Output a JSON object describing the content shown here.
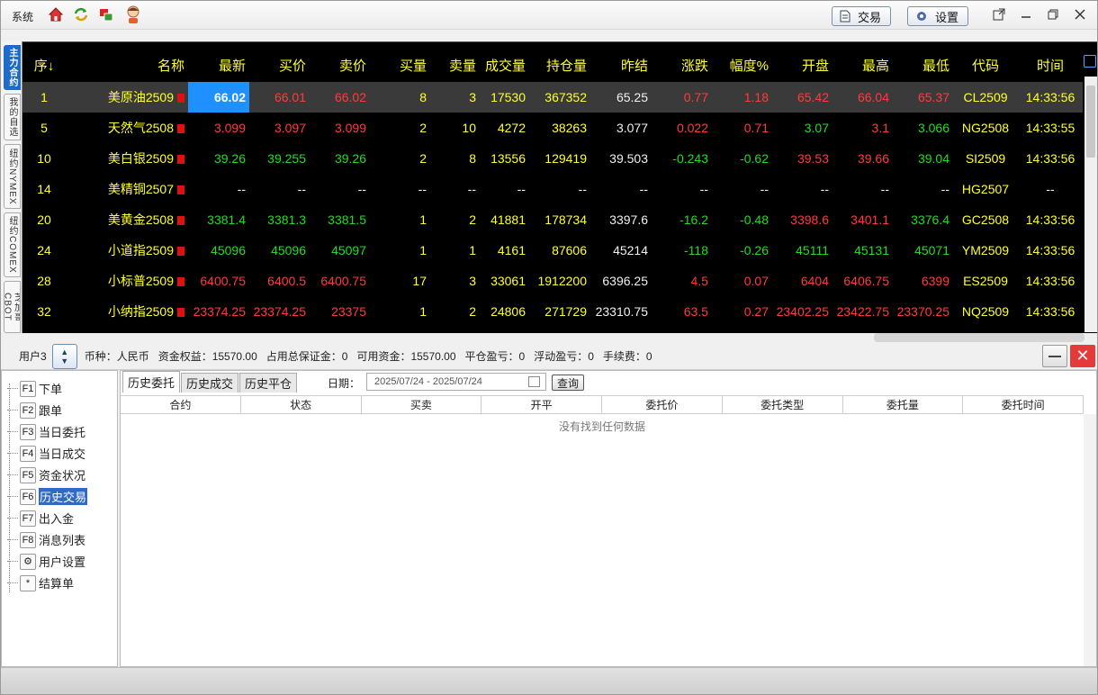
{
  "titlebar": {
    "menu_system": "系统",
    "btn_trade": "交易",
    "btn_settings": "设置"
  },
  "side_tabs": [
    "主力合约",
    "我的自选",
    "纽约NYMEX",
    "纽约COMEX",
    "芝加哥CBOT"
  ],
  "quote": {
    "columns": [
      "序↓",
      "名称",
      "最新",
      "买价",
      "卖价",
      "买量",
      "卖量",
      "成交量",
      "持仓量",
      "昨结",
      "涨跌",
      "幅度%",
      "开盘",
      "最高",
      "最低",
      "代码",
      "时间"
    ],
    "rows": [
      {
        "seq": "1",
        "name": "美原油2509",
        "last": "66.02",
        "bid": "66.01",
        "ask": "66.02",
        "bidv": "8",
        "askv": "3",
        "vol": "17530",
        "oi": "367352",
        "prev": "65.25",
        "chg": "0.77",
        "pct": "1.18",
        "open": "65.42",
        "high": "66.04",
        "low": "65.37",
        "code": "CL2509",
        "time": "14:33:56"
      },
      {
        "seq": "5",
        "name": "天然气2508",
        "last": "3.099",
        "bid": "3.097",
        "ask": "3.099",
        "bidv": "2",
        "askv": "10",
        "vol": "4272",
        "oi": "38263",
        "prev": "3.077",
        "chg": "0.022",
        "pct": "0.71",
        "open": "3.07",
        "high": "3.1",
        "low": "3.066",
        "code": "NG2508",
        "time": "14:33:55"
      },
      {
        "seq": "10",
        "name": "美白银2509",
        "last": "39.26",
        "bid": "39.255",
        "ask": "39.26",
        "bidv": "2",
        "askv": "8",
        "vol": "13556",
        "oi": "129419",
        "prev": "39.503",
        "chg": "-0.243",
        "pct": "-0.62",
        "open": "39.53",
        "high": "39.66",
        "low": "39.04",
        "code": "SI2509",
        "time": "14:33:56"
      },
      {
        "seq": "14",
        "name": "美精铜2507",
        "last": "--",
        "bid": "--",
        "ask": "--",
        "bidv": "--",
        "askv": "--",
        "vol": "--",
        "oi": "--",
        "prev": "--",
        "chg": "--",
        "pct": "--",
        "open": "--",
        "high": "--",
        "low": "--",
        "code": "HG2507",
        "time": "--"
      },
      {
        "seq": "20",
        "name": "美黄金2508",
        "last": "3381.4",
        "bid": "3381.3",
        "ask": "3381.5",
        "bidv": "1",
        "askv": "2",
        "vol": "41881",
        "oi": "178734",
        "prev": "3397.6",
        "chg": "-16.2",
        "pct": "-0.48",
        "open": "3398.6",
        "high": "3401.1",
        "low": "3376.4",
        "code": "GC2508",
        "time": "14:33:56"
      },
      {
        "seq": "24",
        "name": "小道指2509",
        "last": "45096",
        "bid": "45096",
        "ask": "45097",
        "bidv": "1",
        "askv": "1",
        "vol": "4161",
        "oi": "87606",
        "prev": "45214",
        "chg": "-118",
        "pct": "-0.26",
        "open": "45111",
        "high": "45131",
        "low": "45071",
        "code": "YM2509",
        "time": "14:33:56"
      },
      {
        "seq": "28",
        "name": "小标普2509",
        "last": "6400.75",
        "bid": "6400.5",
        "ask": "6400.75",
        "bidv": "17",
        "askv": "3",
        "vol": "33061",
        "oi": "1912200",
        "prev": "6396.25",
        "chg": "4.5",
        "pct": "0.07",
        "open": "6404",
        "high": "6406.75",
        "low": "6399",
        "code": "ES2509",
        "time": "14:33:56"
      },
      {
        "seq": "32",
        "name": "小纳指2509",
        "last": "23374.25",
        "bid": "23374.25",
        "ask": "23375",
        "bidv": "1",
        "askv": "2",
        "vol": "24806",
        "oi": "271729",
        "prev": "23310.75",
        "chg": "63.5",
        "pct": "0.27",
        "open": "23402.25",
        "high": "23422.75",
        "low": "23370.25",
        "code": "NQ2509",
        "time": "14:33:56"
      }
    ]
  },
  "account": {
    "user": "用户3",
    "currency": "币种：人民币",
    "equity": "资金权益：15570.00",
    "margin": "占用总保证金：0",
    "available": "可用资金：15570.00",
    "close_pl": "平仓盈亏：0",
    "float_pl": "浮动盈亏：0",
    "fee": "手续费：0"
  },
  "fmenu": [
    {
      "key": "F1",
      "label": "下单"
    },
    {
      "key": "F2",
      "label": "跟单"
    },
    {
      "key": "F3",
      "label": "当日委托"
    },
    {
      "key": "F4",
      "label": "当日成交"
    },
    {
      "key": "F5",
      "label": "资金状况"
    },
    {
      "key": "F6",
      "label": "历史交易"
    },
    {
      "key": "F7",
      "label": "出入金"
    },
    {
      "key": "F8",
      "label": "消息列表"
    },
    {
      "key": "⚙",
      "label": "用户设置"
    },
    {
      "key": "*",
      "label": "结算单"
    }
  ],
  "history": {
    "tabs": [
      "历史委托",
      "历史成交",
      "历史平仓"
    ],
    "date_label": "日期：",
    "date_range": "2025/07/24 - 2025/07/24",
    "query": "查询",
    "columns": [
      "合约",
      "状态",
      "买卖",
      "开平",
      "委托价",
      "委托类型",
      "委托量",
      "委托时间"
    ],
    "empty": "没有找到任何数据"
  }
}
